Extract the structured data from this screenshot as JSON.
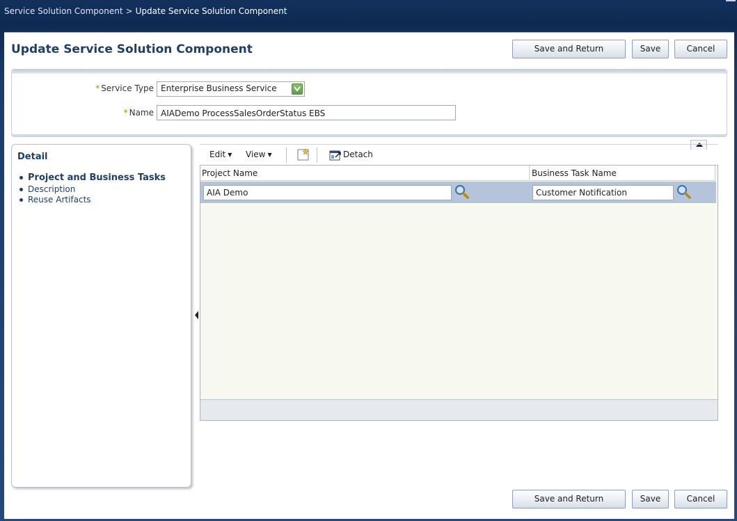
{
  "breadcrumb": {
    "parent": "Service Solution Component",
    "separator": ">",
    "current": "Update Service Solution Component"
  },
  "page": {
    "title": "Update Service Solution Component"
  },
  "actions": {
    "save_and_return": "Save and Return",
    "save": "Save",
    "cancel": "Cancel"
  },
  "form": {
    "required_marker": "*",
    "service_type_label": "Service Type",
    "service_type_value": "Enterprise Business Service",
    "name_label": "Name",
    "name_value": "AIADemo ProcessSalesOrderStatus EBS"
  },
  "detail": {
    "title": "Detail",
    "items": [
      {
        "label": "Project and Business Tasks",
        "active": true
      },
      {
        "label": "Description",
        "active": false
      },
      {
        "label": "Reuse Artifacts",
        "active": false
      }
    ]
  },
  "toolbar": {
    "edit": "Edit",
    "view": "View",
    "detach": "Detach",
    "icons": [
      "new-row-icon",
      "detach-icon"
    ]
  },
  "table": {
    "columns": [
      "Project Name",
      "Business Task Name"
    ],
    "rows": [
      {
        "project": "AIA Demo",
        "task": "Customer Notification"
      }
    ]
  },
  "colors": {
    "title_blue": "#1f3f66",
    "selected_row": "#b5c4db",
    "dropdown_green": "#6aa84f"
  }
}
